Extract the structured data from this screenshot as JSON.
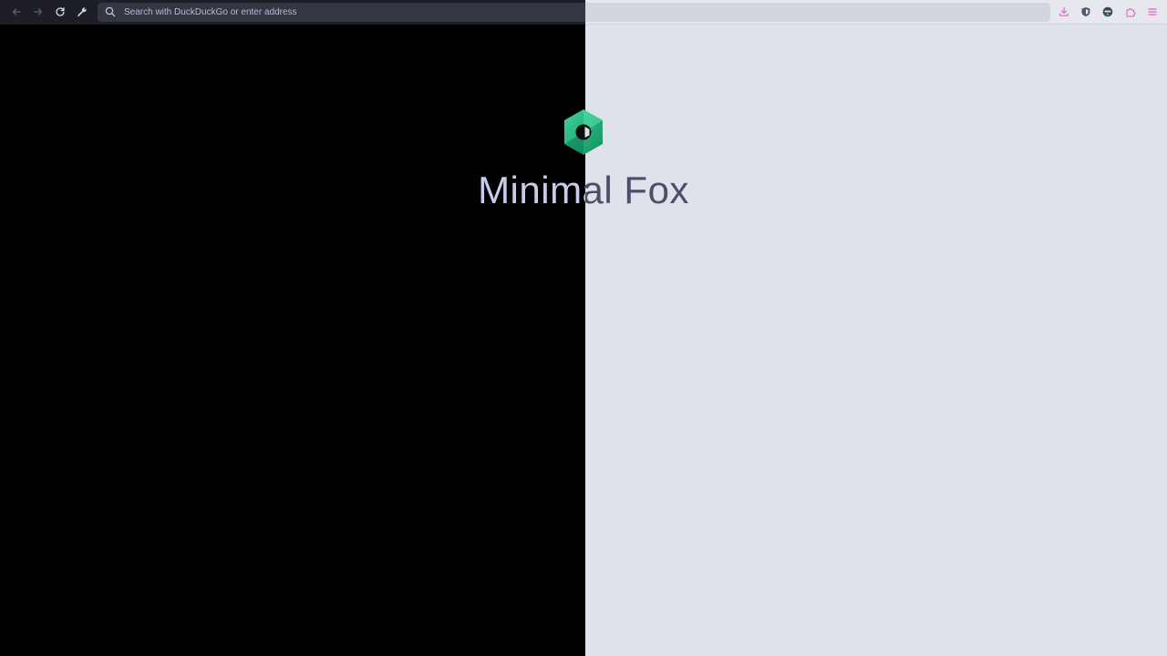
{
  "browser": {
    "urlbar": {
      "placeholder": "Search with DuckDuckGo or enter address"
    }
  },
  "icons": {
    "back": "back-arrow-icon",
    "forward": "forward-arrow-icon",
    "reload": "reload-icon",
    "customize": "wrench-icon",
    "search": "search-icon",
    "downloads": "download-icon",
    "shield": "shield-icon",
    "account": "account-icon",
    "extensions": "puzzle-icon",
    "menu": "hamburger-menu-icon"
  },
  "page": {
    "title": "Minimal Fox"
  },
  "colors": {
    "left_background": "#000000",
    "right_background": "#dfe2ea",
    "accent_pink": "#e05fc4",
    "logo_green": "#1fb57f"
  }
}
